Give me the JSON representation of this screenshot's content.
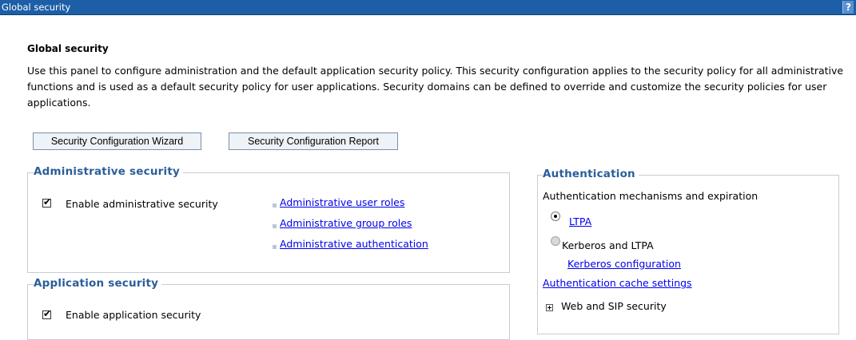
{
  "titlebar": {
    "title": "Global security",
    "help_label": "?"
  },
  "panel": {
    "heading": "Global security",
    "intro": "Use this panel to configure administration and the default application security policy. This security configuration applies to the security policy for all administrative functions and is used as a default security policy for user applications. Security domains can be defined to override and customize the security policies for user applications."
  },
  "buttons": {
    "wizard": "Security Configuration Wizard",
    "report": "Security Configuration Report"
  },
  "admin_security": {
    "legend": "Administrative security",
    "checkbox_label": "Enable administrative security",
    "checked": true,
    "links": [
      "Administrative user roles",
      "Administrative group roles",
      "Administrative authentication"
    ]
  },
  "app_security": {
    "legend": "Application security",
    "checkbox_label": "Enable application security",
    "checked": true
  },
  "authentication": {
    "legend": "Authentication",
    "mechanisms_label": "Authentication mechanisms and expiration",
    "options": [
      {
        "label": "LTPA",
        "selected": true,
        "is_link": true
      },
      {
        "label": "Kerberos and LTPA",
        "selected": false,
        "is_link": false
      }
    ],
    "kerberos_link": "Kerberos configuration",
    "cache_link": "Authentication cache settings",
    "web_sip": "Web and SIP security"
  },
  "colors": {
    "titlebar_bg": "#1d5fa6",
    "legend_text": "#2a5e9a",
    "link": "#0000ee"
  }
}
